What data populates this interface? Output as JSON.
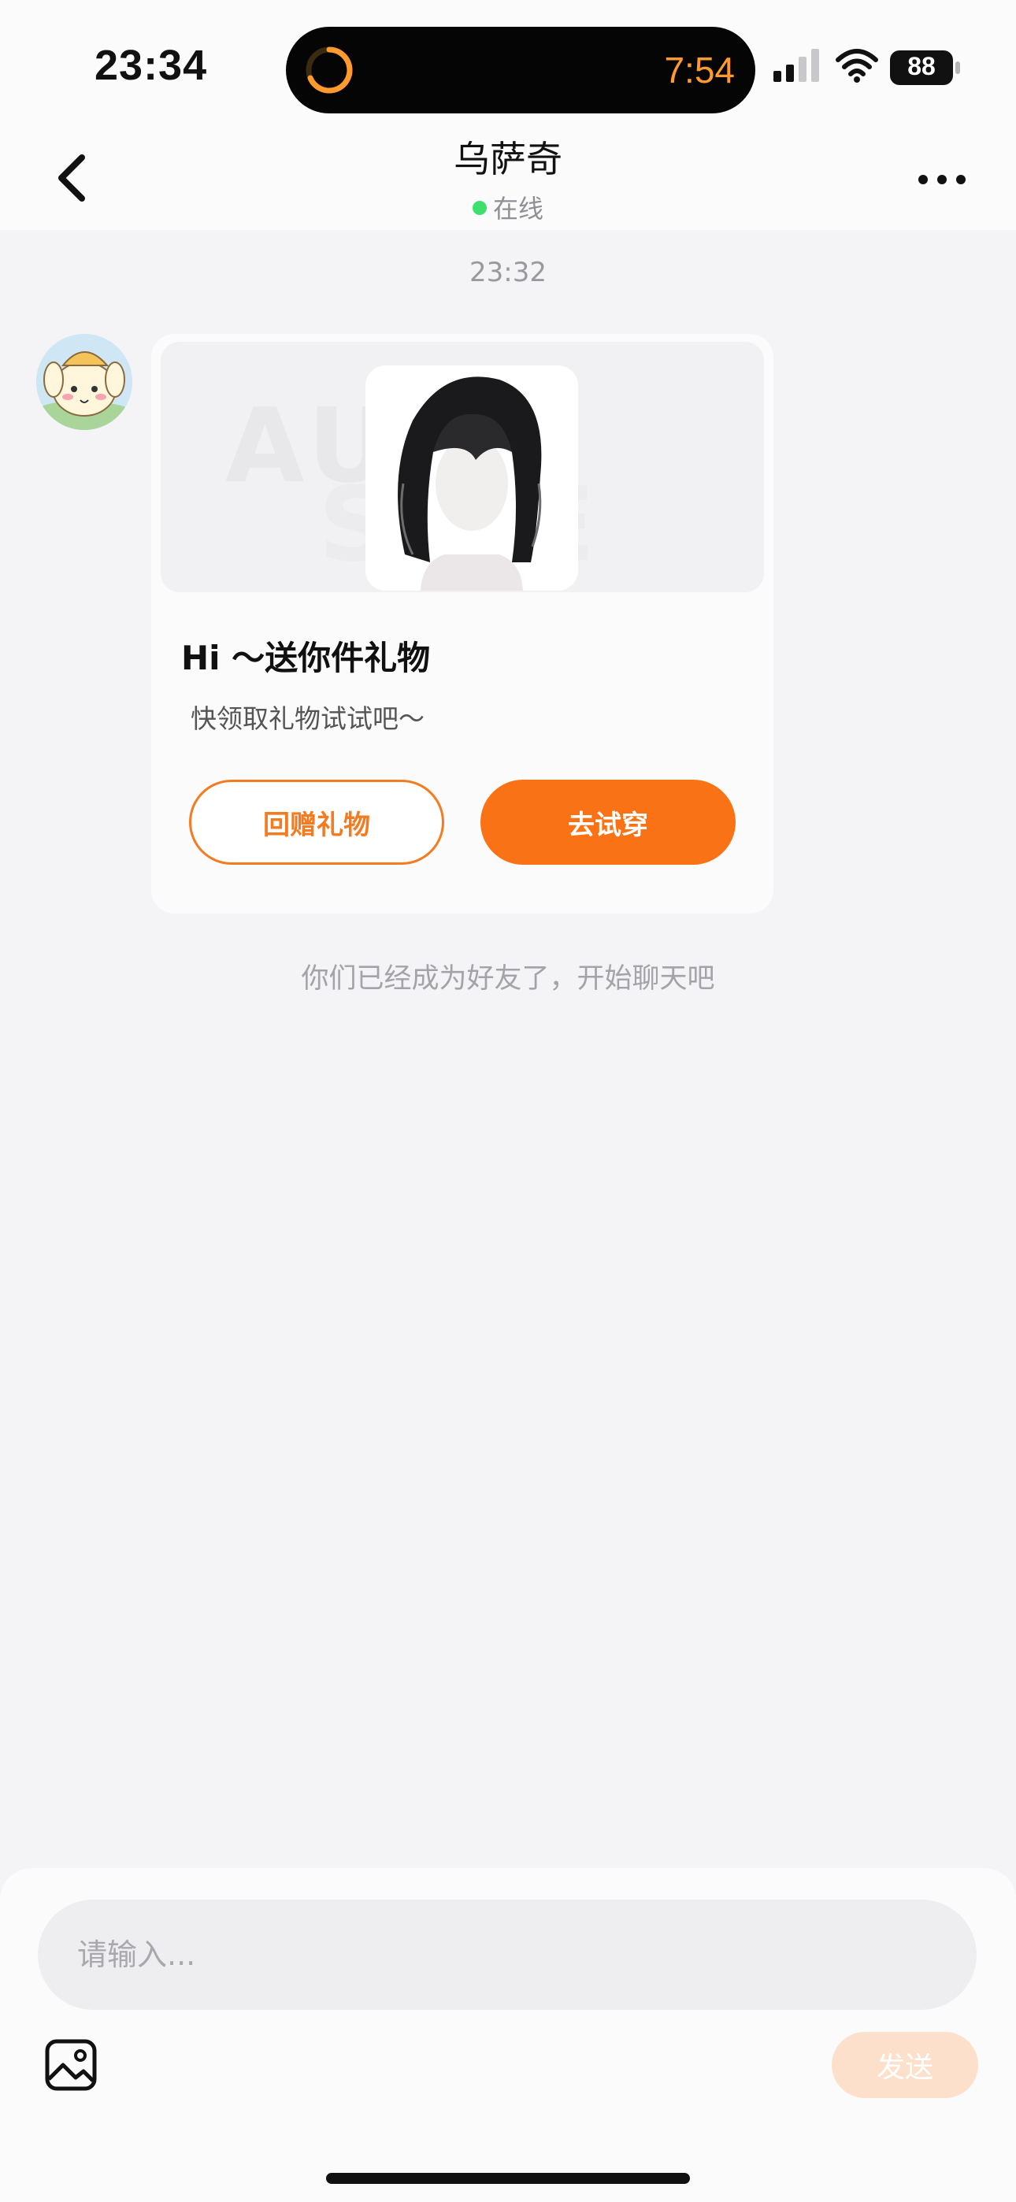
{
  "status_bar": {
    "time": "23:34",
    "island_timer": "7:54",
    "battery": "88"
  },
  "header": {
    "title": "乌萨奇",
    "status": "在线"
  },
  "chat": {
    "timestamp": "23:32",
    "card": {
      "watermark_line1": "AU R",
      "watermark_line2": "S RE",
      "title": "Hi ～送你件礼物",
      "subtitle": "快领取礼物试试吧～",
      "return_gift_label": "回赠礼物",
      "try_on_label": "去试穿"
    },
    "notice": "你们已经成为好友了，开始聊天吧"
  },
  "composer": {
    "placeholder": "请输入...",
    "send_label": "发送"
  },
  "colors": {
    "accent": "#f97316",
    "send_disabled": "#fde0cc",
    "online": "#3ee06d"
  },
  "icons": [
    "back-chevron-icon",
    "more-icon",
    "image-icon",
    "timer-icon",
    "signal-icon",
    "wifi-icon",
    "battery-icon"
  ]
}
